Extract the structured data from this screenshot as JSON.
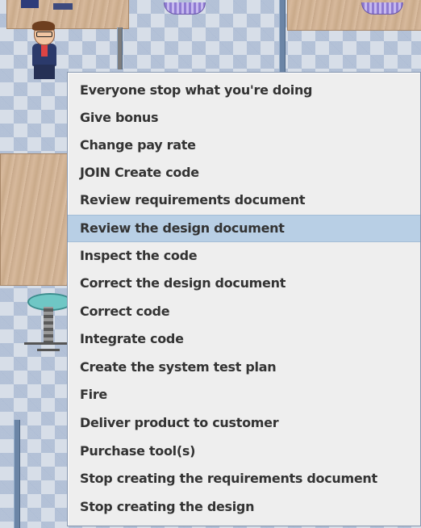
{
  "scene": {
    "avatar": "office-worker-avatar",
    "objects": [
      "desk",
      "chair",
      "trash-bin",
      "pillar"
    ]
  },
  "context_menu": {
    "selected_index": 5,
    "items": [
      {
        "label": "Everyone stop what you're doing"
      },
      {
        "label": "Give bonus"
      },
      {
        "label": "Change pay rate"
      },
      {
        "label": "JOIN Create code"
      },
      {
        "label": "Review requirements document"
      },
      {
        "label": "Review the design document"
      },
      {
        "label": "Inspect the code"
      },
      {
        "label": "Correct the design document"
      },
      {
        "label": "Correct code"
      },
      {
        "label": "Integrate code"
      },
      {
        "label": "Create the system test plan"
      },
      {
        "label": "Fire"
      },
      {
        "label": "Deliver product to customer"
      },
      {
        "label": "Purchase tool(s)"
      },
      {
        "label": "Stop creating the requirements document"
      },
      {
        "label": "Stop creating the design"
      }
    ]
  },
  "colors": {
    "menu_bg": "#eeeeee",
    "menu_border": "#8595ad",
    "highlight": "#b8cfe5",
    "text": "#333333"
  }
}
